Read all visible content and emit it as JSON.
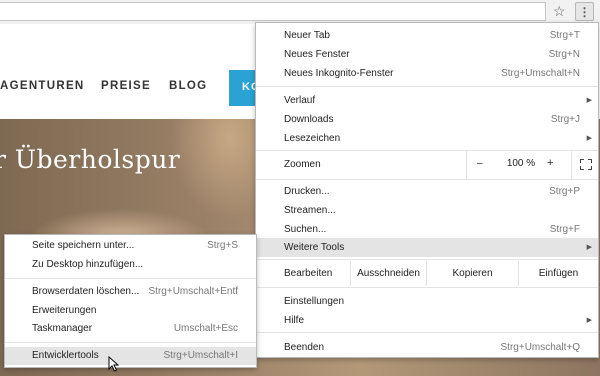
{
  "browser": {
    "star_icon": "star-icon",
    "menu_icon": "vertical-dots-icon"
  },
  "webpage": {
    "nav": [
      "AGENTUREN",
      "PREISE",
      "BLOG"
    ],
    "cta_partial": "KO",
    "hero_title": "r Überholspur"
  },
  "menu": {
    "items": [
      {
        "label": "Neuer Tab",
        "shortcut": "Strg+T"
      },
      {
        "label": "Neues Fenster",
        "shortcut": "Strg+N"
      },
      {
        "label": "Neues Inkognito-Fenster",
        "shortcut": "Strg+Umschalt+N"
      },
      {
        "label": "Verlauf",
        "shortcut": ""
      },
      {
        "label": "Downloads",
        "shortcut": "Strg+J"
      },
      {
        "label": "Lesezeichen",
        "shortcut": ""
      },
      {
        "label": "Drucken...",
        "shortcut": "Strg+P"
      },
      {
        "label": "Streamen...",
        "shortcut": ""
      },
      {
        "label": "Suchen...",
        "shortcut": "Strg+F"
      },
      {
        "label": "Weitere Tools",
        "shortcut": ""
      },
      {
        "label": "Einstellungen",
        "shortcut": ""
      },
      {
        "label": "Hilfe",
        "shortcut": ""
      },
      {
        "label": "Beenden",
        "shortcut": "Strg+Umschalt+Q"
      }
    ],
    "zoom": {
      "label": "Zoomen",
      "minus": "–",
      "value": "100 %",
      "plus": "+"
    },
    "edit": {
      "label": "Bearbeiten",
      "cut": "Ausschneiden",
      "copy": "Kopieren",
      "paste": "Einfügen"
    },
    "highlighted": "Weitere Tools"
  },
  "submenu": {
    "items": [
      {
        "label": "Seite speichern unter...",
        "shortcut": "Strg+S"
      },
      {
        "label": "Zu Desktop hinzufügen...",
        "shortcut": ""
      },
      {
        "label": "Browserdaten löschen...",
        "shortcut": "Strg+Umschalt+Entf"
      },
      {
        "label": "Erweiterungen",
        "shortcut": ""
      },
      {
        "label": "Taskmanager",
        "shortcut": "Umschalt+Esc"
      },
      {
        "label": "Entwicklertools",
        "shortcut": "Strg+Umschalt+I"
      }
    ],
    "highlighted": "Entwicklertools"
  }
}
